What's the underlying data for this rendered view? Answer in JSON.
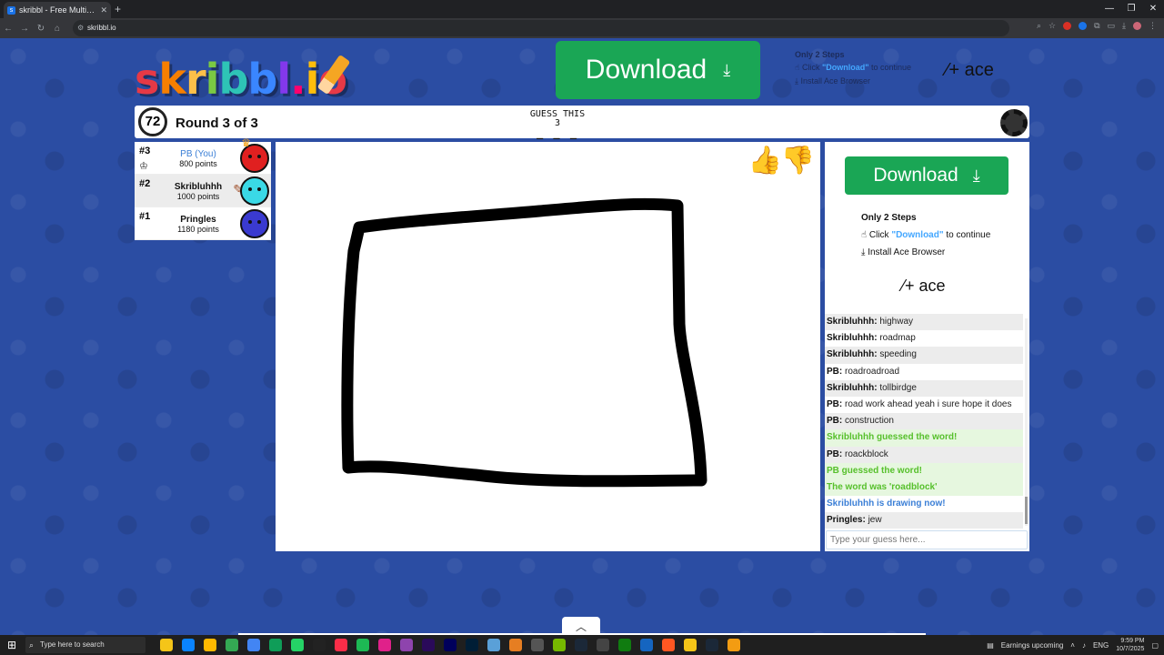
{
  "browser": {
    "tab_title": "skribbl - Free Multiplayer Drawi",
    "url": "skribbl.io",
    "new_tab": "+",
    "minimize": "—",
    "maximize": "❐",
    "close": "✕"
  },
  "logo": {
    "text": "skribbl.io"
  },
  "ad_top": {
    "download_label": "Download",
    "steps_title": "Only 2 Steps",
    "step1_prefix": "Click ",
    "step1_highlight": "\"Download\"",
    "step1_suffix": " to continue",
    "step2": "Install Ace Browser",
    "brand": "ace"
  },
  "game": {
    "timer": "72",
    "round": "Round 3 of 3",
    "guess_title": "GUESS THIS",
    "guess_count": "3",
    "guess_blanks": "_ _ _"
  },
  "players": [
    {
      "rank": "#3",
      "name": "PB (You)",
      "points": "800 points",
      "color": "#e02020"
    },
    {
      "rank": "#2",
      "name": "Skribluhhh",
      "points": "1000 points",
      "color": "#3ad9e6"
    },
    {
      "rank": "#1",
      "name": "Pringles",
      "points": "1180 points",
      "color": "#3a3ad0"
    }
  ],
  "ad_side": {
    "download_label": "Download",
    "steps_title": "Only 2 Steps",
    "step1_prefix": "Click ",
    "step1_highlight": "\"Download\"",
    "step1_suffix": " to continue",
    "step2": "Install Ace Browser",
    "brand": "ace"
  },
  "chat": [
    {
      "name": "Skribluhhh:",
      "text": " highway",
      "type": "normal"
    },
    {
      "name": "Skribluhhh:",
      "text": " roadmap",
      "type": "normal"
    },
    {
      "name": "Skribluhhh:",
      "text": " speeding",
      "type": "normal"
    },
    {
      "name": "PB:",
      "text": " roadroadroad",
      "type": "normal"
    },
    {
      "name": "Skribluhhh:",
      "text": " tollbirdge",
      "type": "normal"
    },
    {
      "name": "PB:",
      "text": " road work ahead yeah i sure hope it does",
      "type": "normal"
    },
    {
      "name": "PB:",
      "text": " construction",
      "type": "normal"
    },
    {
      "name": "",
      "text": "Skribluhhh guessed the word!",
      "type": "green"
    },
    {
      "name": "PB:",
      "text": " roackblock",
      "type": "normal"
    },
    {
      "name": "",
      "text": "PB guessed the word!",
      "type": "green"
    },
    {
      "name": "",
      "text": "The word was 'roadblock'",
      "type": "green"
    },
    {
      "name": "",
      "text": "Skribluhhh is drawing now!",
      "type": "blue"
    },
    {
      "name": "Pringles:",
      "text": " jew",
      "type": "normal"
    }
  ],
  "guess_input": {
    "placeholder": "Type your guess here..."
  },
  "taskbar": {
    "search_placeholder": "Type here to search",
    "earnings": "Earnings upcoming",
    "lang": "ENG",
    "time": "9:59 PM",
    "date": "10/7/2025"
  }
}
